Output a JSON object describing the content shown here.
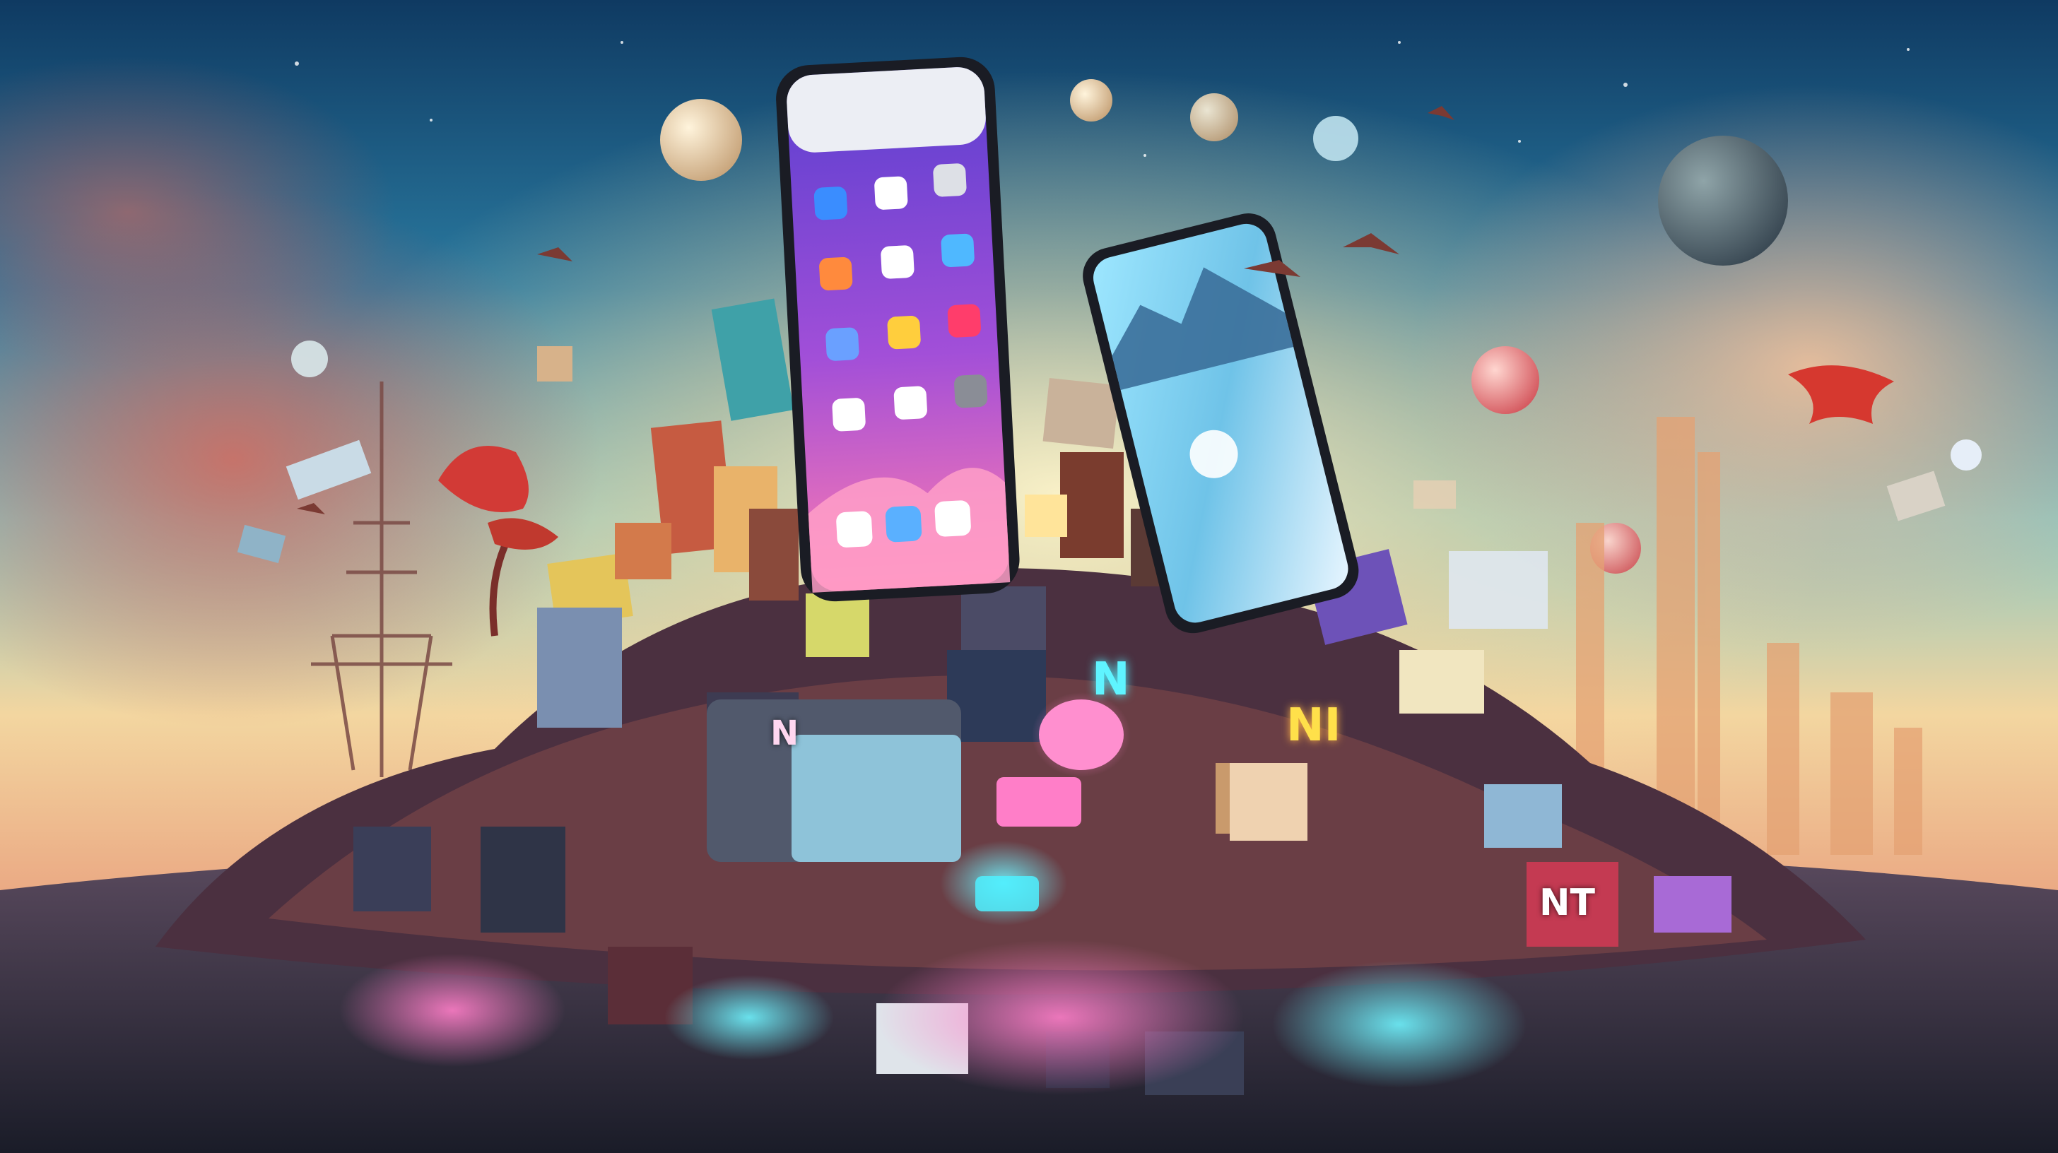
{
  "scene": {
    "subject": "smartphones",
    "palette": {
      "sky_top": "#1d5f8c",
      "sky_mid": "#57a7b8",
      "horizon_glow": "#f7d79a",
      "cloud_left": "#c96a5e",
      "cloud_right": "#f0b28d",
      "ground": "#2b2c3a",
      "screen_purple": "#7a4fd1",
      "screen_pink": "#f06aa8",
      "neon_cyan": "#52f2ff",
      "neon_pink": "#ff5fb8"
    }
  },
  "signs": {
    "left_block_text": "N",
    "center_sign_text": "N",
    "right_sign_text": "NI",
    "right_screen_text": "NT"
  },
  "icons": [
    {
      "name": "mail-app-icon",
      "color": "#3a8dff"
    },
    {
      "name": "text-app-icon",
      "color": "#ffffff"
    },
    {
      "name": "camera-app-icon",
      "color": "#dde0e6"
    },
    {
      "name": "notes-app-icon",
      "color": "#ff8a3d"
    },
    {
      "name": "photos-app-icon",
      "color": "#ffffff"
    },
    {
      "name": "weather-app-icon",
      "color": "#4fb8ff"
    },
    {
      "name": "music-app-icon",
      "color": "#6aa0ff"
    },
    {
      "name": "calendar-app-icon",
      "color": "#ffce3d"
    },
    {
      "name": "star-app-icon",
      "color": "#ff3d6b"
    },
    {
      "name": "messages-app-icon",
      "color": "#ffffff"
    },
    {
      "name": "maps-app-icon",
      "color": "#ffffff"
    },
    {
      "name": "settings-app-icon",
      "color": "#8a8d96"
    },
    {
      "name": "dock-app-icon-1",
      "color": "#ffffff"
    },
    {
      "name": "dock-app-icon-2",
      "color": "#5ab0ff"
    },
    {
      "name": "dock-app-icon-3",
      "color": "#ffffff"
    }
  ]
}
